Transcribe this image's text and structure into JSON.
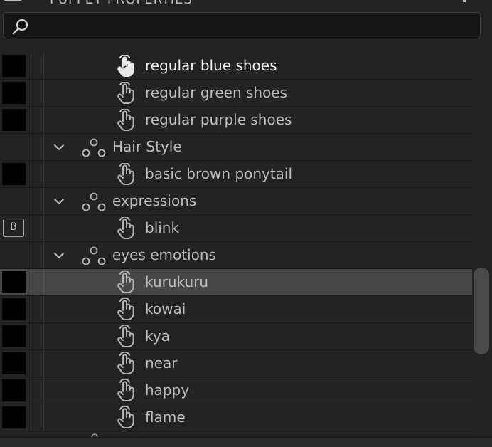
{
  "panel": {
    "title": "PUPPET PROPERTIES",
    "title_icon": "panel-grip-icon",
    "menu_icon": "panel-menu-icon"
  },
  "search": {
    "value": "",
    "placeholder": "",
    "icon": "search-icon"
  },
  "rows": [
    {
      "kind": "item",
      "label": "regular blue shoes",
      "swatch": "black",
      "active": true
    },
    {
      "kind": "item",
      "label": "regular green shoes",
      "swatch": "black"
    },
    {
      "kind": "item",
      "label": "regular purple shoes",
      "swatch": "black"
    },
    {
      "kind": "group",
      "label": "Hair Style",
      "expanded": true
    },
    {
      "kind": "item",
      "label": "basic brown ponytail",
      "swatch": "black"
    },
    {
      "kind": "group",
      "label": "expressions",
      "expanded": true
    },
    {
      "kind": "item",
      "label": "blink",
      "badge": "B"
    },
    {
      "kind": "group",
      "label": "eyes emotions",
      "expanded": true
    },
    {
      "kind": "item",
      "label": "kurukuru",
      "swatch": "black",
      "selected": true
    },
    {
      "kind": "item",
      "label": "kowai",
      "swatch": "black"
    },
    {
      "kind": "item",
      "label": "kya",
      "swatch": "black"
    },
    {
      "kind": "item",
      "label": "near",
      "swatch": "black"
    },
    {
      "kind": "item",
      "label": "happy",
      "swatch": "black"
    },
    {
      "kind": "item",
      "label": "flame",
      "swatch": "black"
    }
  ],
  "colors": {
    "background": "#232323",
    "selected_row": "#474747",
    "text": "#bdbdbd",
    "text_active": "#f0f0f0"
  }
}
